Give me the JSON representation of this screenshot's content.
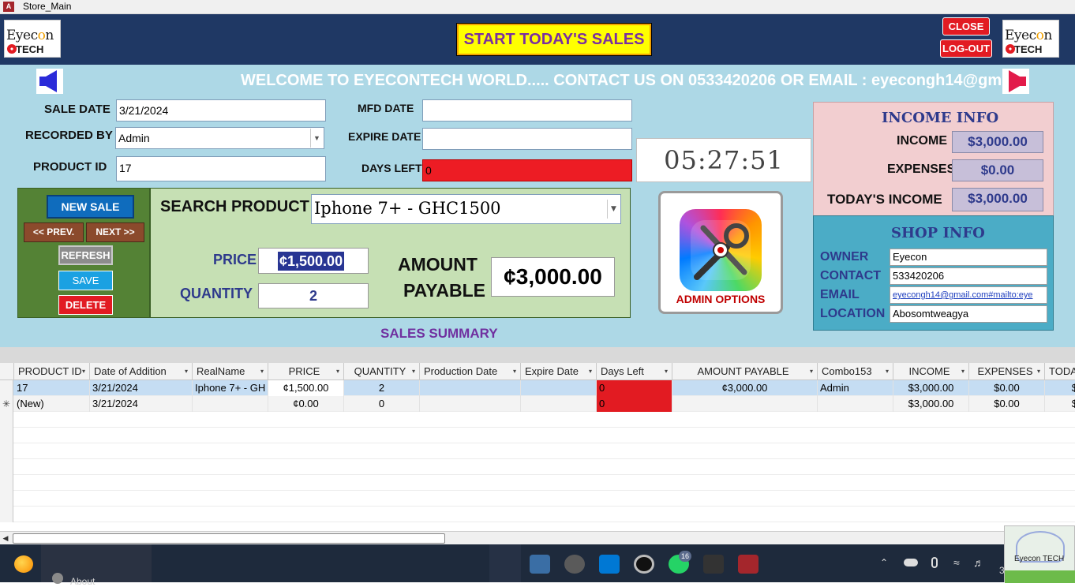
{
  "window": {
    "title": "Store_Main",
    "app_icon": "ms-access-icon"
  },
  "header": {
    "logo_text": "Eyecon",
    "logo_sub": "TECH",
    "start_button": "START TODAY'S SALES",
    "close_button": "CLOSE",
    "logout_button": "LOG-OUT"
  },
  "marquee": "WELCOME TO EYECONTECH WORLD..... CONTACT US ON 0533420206 OR EMAIL : eyecongh14@gm",
  "form": {
    "sale_date_label": "SALE DATE",
    "sale_date": "3/21/2024",
    "recorded_by_label": "RECORDED BY",
    "recorded_by": "Admin",
    "product_id_label": "PRODUCT ID",
    "product_id": "17",
    "mfd_date_label": "MFD  DATE",
    "mfd_date": "",
    "expire_date_label": "EXPIRE DATE",
    "expire_date": "",
    "days_left_label": "DAYS LEFT",
    "days_left": "0"
  },
  "clock": "05:27:51 AM",
  "buttons": {
    "new_sale": "NEW SALE",
    "prev": "<< PREV.",
    "next": "NEXT >>",
    "refresh": "REFRESH",
    "save": "SAVE",
    "delete": "DELETE"
  },
  "sale": {
    "search_label": "SEARCH PRODUCT",
    "search_value": "Iphone 7+ - GHC1500",
    "price_label": "PRICE",
    "price": "¢1,500.00",
    "quantity_label": "QUANTITY",
    "quantity": "2",
    "amount_label_1": "AMOUNT",
    "amount_label_2": "PAYABLE",
    "amount": "¢3,000.00"
  },
  "admin": {
    "label": "ADMIN OPTIONS"
  },
  "income_info": {
    "title": "INCOME INFO",
    "income_label": "INCOME",
    "income": "$3,000.00",
    "expenses_label": "EXPENSES",
    "expenses": "$0.00",
    "today_label": "TODAY'S INCOME",
    "today": "$3,000.00"
  },
  "shop_info": {
    "title": "SHOP INFO",
    "owner_label": "OWNER",
    "owner": "Eyecon",
    "contact_label": "CONTACT",
    "contact": "533420206",
    "email_label": "EMAIL",
    "email": "eyecongh14@gmail.com#mailto:eye",
    "location_label": "LOCATION",
    "location": "Abosomtweagya"
  },
  "summary_label": "SALES SUMMARY",
  "table": {
    "columns": [
      "PRODUCT ID",
      "Date of Addition",
      "RealName",
      "PRICE",
      "QUANTITY",
      "Production Date",
      "Expire Date",
      "Days Left",
      "AMOUNT PAYABLE",
      "Combo153",
      "INCOME",
      "EXPENSES",
      "TODA"
    ],
    "rows": [
      [
        "17",
        "3/21/2024",
        "Iphone 7+ - GH",
        "¢1,500.00",
        "2",
        "",
        "",
        "0",
        "¢3,000.00",
        "Admin",
        "$3,000.00",
        "$0.00",
        "$"
      ],
      [
        "(New)",
        "3/21/2024",
        "",
        "¢0.00",
        "0",
        "",
        "",
        "0",
        "",
        "",
        "$3,000.00",
        "$0.00",
        "$"
      ]
    ],
    "new_row_marker": "✳"
  },
  "taskbar": {
    "menu_item_partial": "About",
    "whatsapp_badge": "16",
    "corner_logo": "Eyecon TECH",
    "clock_partial": "3"
  }
}
